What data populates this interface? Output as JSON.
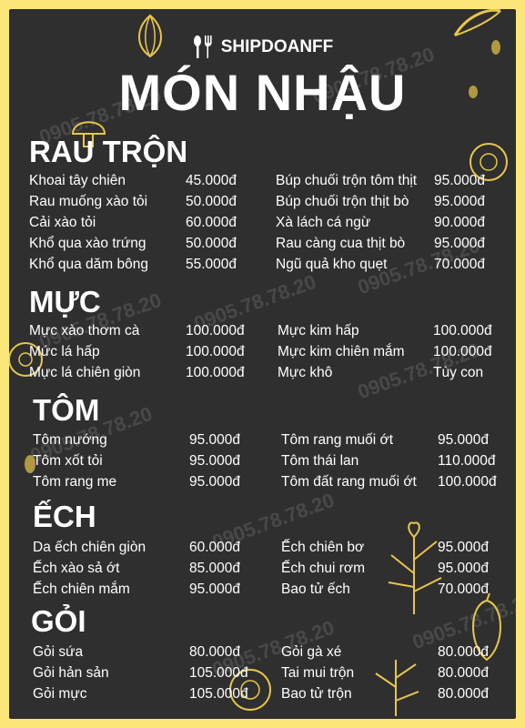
{
  "brand": {
    "name": "SHIPDOANFF",
    "icon": "fork-spoon-icon"
  },
  "title": "MÓN NHẬU",
  "watermark": "0905.78.78.20",
  "colors": {
    "background": "#2f2f2f",
    "frame": "#fbe67a",
    "text": "#ffffff",
    "decoration": "#e8c64a"
  },
  "sections": [
    {
      "title": "RAU TRỘN",
      "items": [
        {
          "name": "Khoai tây chiên",
          "price": "45.000đ"
        },
        {
          "name": "Rau muống xào tỏi",
          "price": "50.000đ"
        },
        {
          "name": "Cải xào tỏi",
          "price": "60.000đ"
        },
        {
          "name": "Khổ qua xào trứng",
          "price": "50.000đ"
        },
        {
          "name": "Khổ qua dăm bông",
          "price": "55.000đ"
        },
        {
          "name": "Búp chuối trộn tôm thịt",
          "price": "95.000đ"
        },
        {
          "name": "Búp chuối trộn thịt bò",
          "price": "95.000đ"
        },
        {
          "name": "Xà lách cá ngừ",
          "price": "90.000đ"
        },
        {
          "name": "Rau càng cua thịt bò",
          "price": "95.000đ"
        },
        {
          "name": "Ngũ quả kho quẹt",
          "price": "70.000đ"
        }
      ]
    },
    {
      "title": "MỰC",
      "items": [
        {
          "name": "Mực xào thơm cà",
          "price": "100.000đ"
        },
        {
          "name": "Mức lá hấp",
          "price": "100.000đ"
        },
        {
          "name": "Mực lá chiên giòn",
          "price": "100.000đ"
        },
        {
          "name": "Mực kim hấp",
          "price": "100.000đ"
        },
        {
          "name": "Mực kim chiên mắm",
          "price": "100.000đ"
        },
        {
          "name": "Mực khô",
          "price": "Tùy con"
        }
      ]
    },
    {
      "title": "TÔM",
      "items": [
        {
          "name": "Tôm nướng",
          "price": "95.000đ"
        },
        {
          "name": "Tôm xốt tỏi",
          "price": "95.000đ"
        },
        {
          "name": "Tôm rang me",
          "price": "95.000đ"
        },
        {
          "name": "Tôm rang muối ớt",
          "price": "95.000đ"
        },
        {
          "name": "Tôm thái lan",
          "price": "110.000đ"
        },
        {
          "name": "Tôm đất rang muối ớt",
          "price": "100.000đ"
        }
      ]
    },
    {
      "title": "ẾCH",
      "items": [
        {
          "name": "Da ếch chiên giòn",
          "price": "60.000đ"
        },
        {
          "name": "Ếch xào sả ớt",
          "price": "85.000đ"
        },
        {
          "name": "Ếch chiên mắm",
          "price": "95.000đ"
        },
        {
          "name": "Ếch chiên bơ",
          "price": "95.000đ"
        },
        {
          "name": "Ếch chui rơm",
          "price": "95.000đ"
        },
        {
          "name": "Bao tử ếch",
          "price": "70.000đ"
        }
      ]
    },
    {
      "title": "GỎI",
      "items": [
        {
          "name": "Gỏi sứa",
          "price": "80.000đ"
        },
        {
          "name": "Gỏi hản sản",
          "price": "105.000đ"
        },
        {
          "name": "Gỏi mực",
          "price": "105.000đ"
        },
        {
          "name": "Gỏi gà xé",
          "price": "80.000đ"
        },
        {
          "name": "Tai mui trộn",
          "price": "80.000đ"
        },
        {
          "name": "Bao tử trộn",
          "price": "80.000đ"
        }
      ]
    }
  ]
}
